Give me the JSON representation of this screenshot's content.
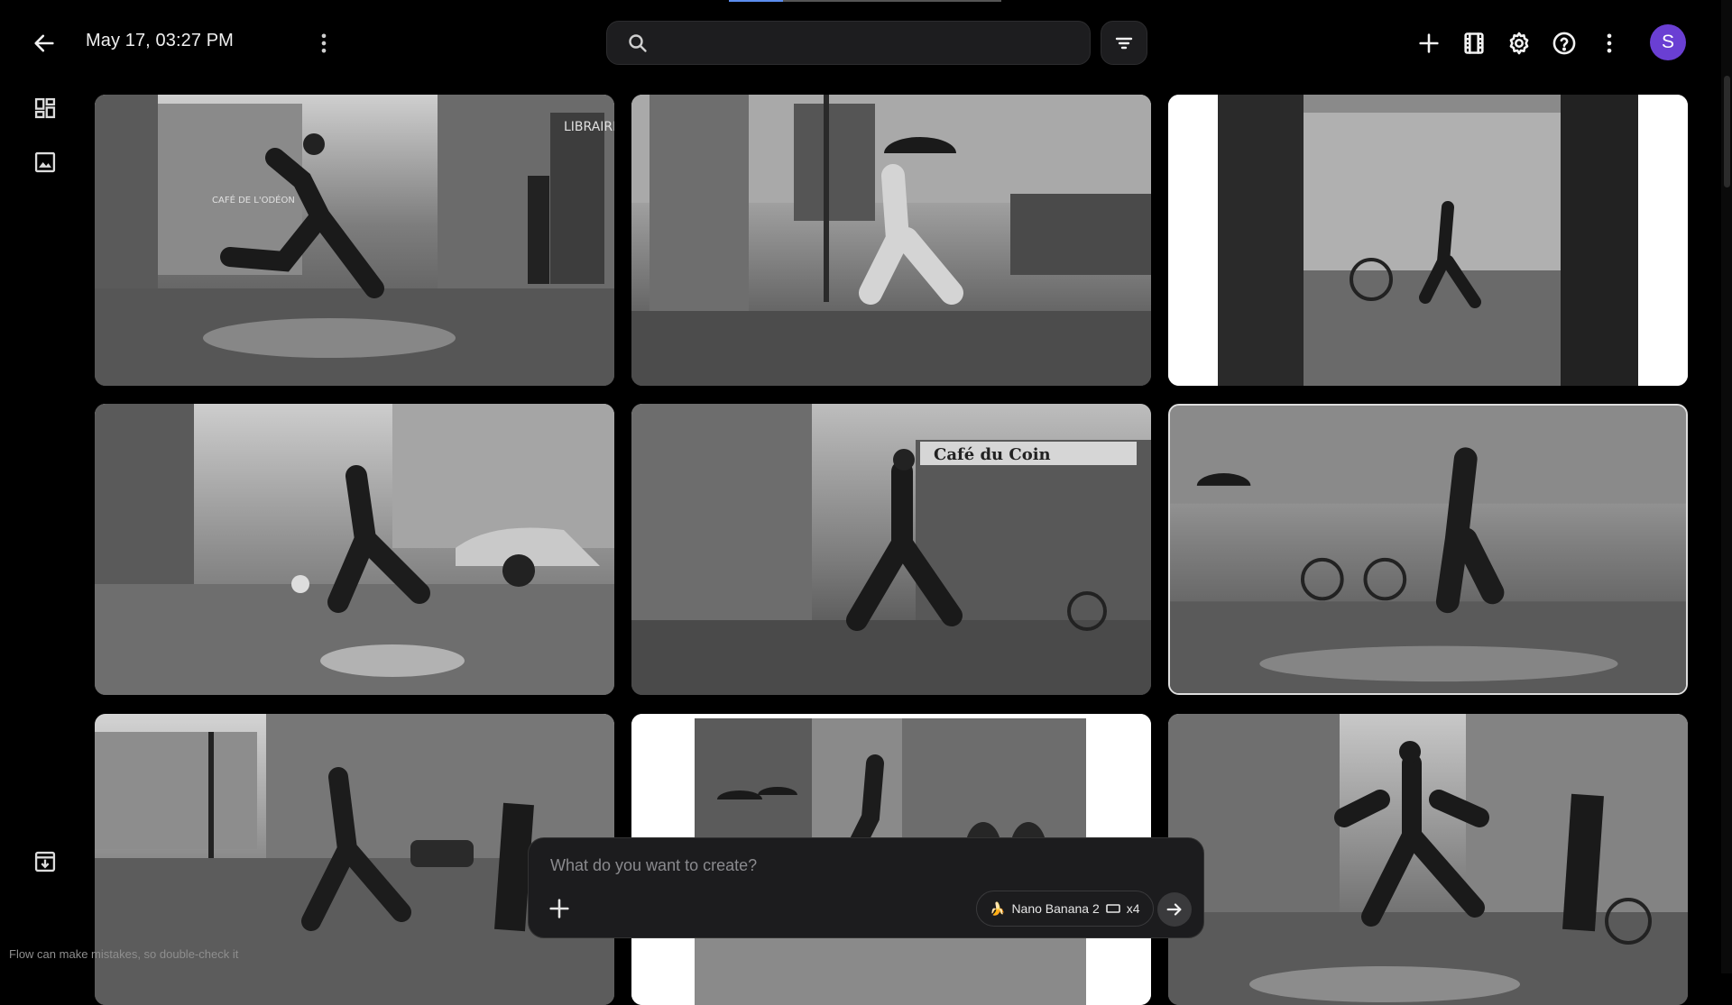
{
  "header": {
    "title": "May 17, 03:27 PM",
    "search_placeholder": "",
    "avatar_initial": "S"
  },
  "icons": {
    "back": "arrow-left-icon",
    "overflow": "more-vertical-icon",
    "search": "search-icon",
    "filter": "filter-icon",
    "add": "plus-icon",
    "film": "film-icon",
    "settings": "gear-icon",
    "help": "help-circle-icon",
    "more": "more-vertical-icon",
    "grid_view": "dashboard-icon",
    "image_view": "image-icon",
    "download": "download-box-icon"
  },
  "sign_text": {
    "cafe": "Café du Coin",
    "librairie": "LIBRAIRIE",
    "cafe_odeon": "CAFÉ DE L'ODÉON"
  },
  "gallery": [
    {
      "alt": "Man leaping over puddle on Parisian cobbled street"
    },
    {
      "alt": "Man with umbrella leaping near market stalls"
    },
    {
      "alt": "Pedestrians and cyclist framed by open doorway"
    },
    {
      "alt": "Man leaping beside a vintage car and small dog"
    },
    {
      "alt": "Man in hat leaping past Café du Coin"
    },
    {
      "alt": "Man leaping puddle near cyclists in the rain"
    },
    {
      "alt": "Man leaping on riverside street with lamp post"
    },
    {
      "alt": "Man running past umbrellas on arcade street"
    },
    {
      "alt": "Man in suit leaping puddle on narrow street"
    }
  ],
  "prompt": {
    "placeholder": "What do you want to create?",
    "model_label": "Nano Banana 2",
    "count_label": "x4"
  },
  "footer": {
    "note": "Flow can make mistakes, so double-check it"
  },
  "colors": {
    "background": "#000000",
    "avatar": "#6a3fd3",
    "panel": "#1c1c1e",
    "accent_progress": "#5b8def"
  }
}
